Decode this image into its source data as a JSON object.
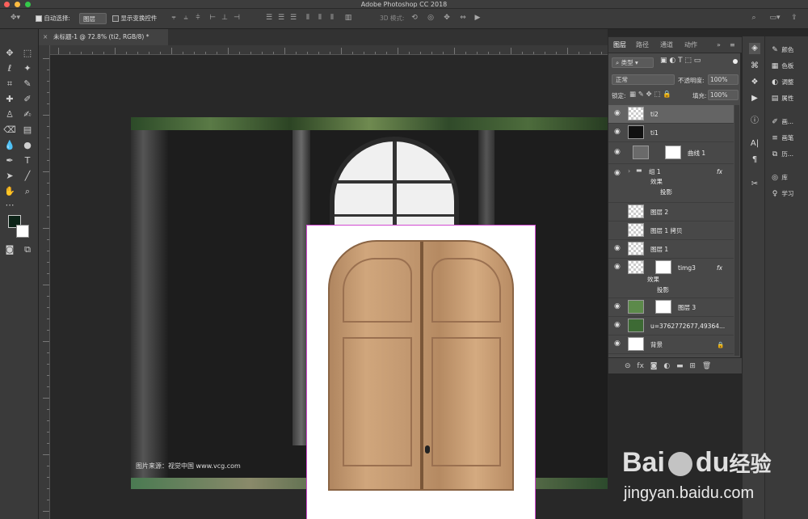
{
  "window": {
    "title": "Adobe Photoshop CC 2018"
  },
  "options_bar": {
    "auto_select_label": "自动选择:",
    "auto_select_value": "图层",
    "show_transform_label": "显示变换控件",
    "three_d_label": "3D 模式:"
  },
  "document_tab": {
    "label": "未标题-1 @ 72.8% (ti2, RGB/8) *"
  },
  "canvas": {
    "caption": "图片来源：视觉中国 www.vcg.com"
  },
  "layers_panel": {
    "tabs": [
      "图层",
      "路径",
      "通道",
      "动作"
    ],
    "filter_label": "类型",
    "blend_mode": "正常",
    "opacity_label": "不透明度:",
    "opacity_value": "100%",
    "lock_label": "锁定:",
    "fill_label": "填充:",
    "fill_value": "100%",
    "layers": [
      {
        "name": "ti2",
        "selected": true
      },
      {
        "name": "ti1"
      },
      {
        "name": "曲线 1"
      },
      {
        "name": "组 1",
        "fx": "fx"
      },
      {
        "name": "图层 2"
      },
      {
        "name": "图层 1 拷贝"
      },
      {
        "name": "图层 1"
      },
      {
        "name": "timg3",
        "fx": "fx"
      },
      {
        "name": "图层 3"
      },
      {
        "name": "u=3762772677,49364..."
      },
      {
        "name": "背景"
      }
    ],
    "effects_label": "效果",
    "drop_shadow_label": "投影"
  },
  "right_panel": {
    "items": [
      "颜色",
      "色板",
      "调整",
      "属性",
      "画...",
      "画笔",
      "历...",
      "库",
      "学习"
    ]
  },
  "watermark": {
    "brand": "Bai",
    "brand2": "du",
    "brand3": "经验",
    "url": "jingyan.baidu.com"
  },
  "colors": {
    "accent": "#4a90e2",
    "selection_border": "#d24bd2"
  }
}
